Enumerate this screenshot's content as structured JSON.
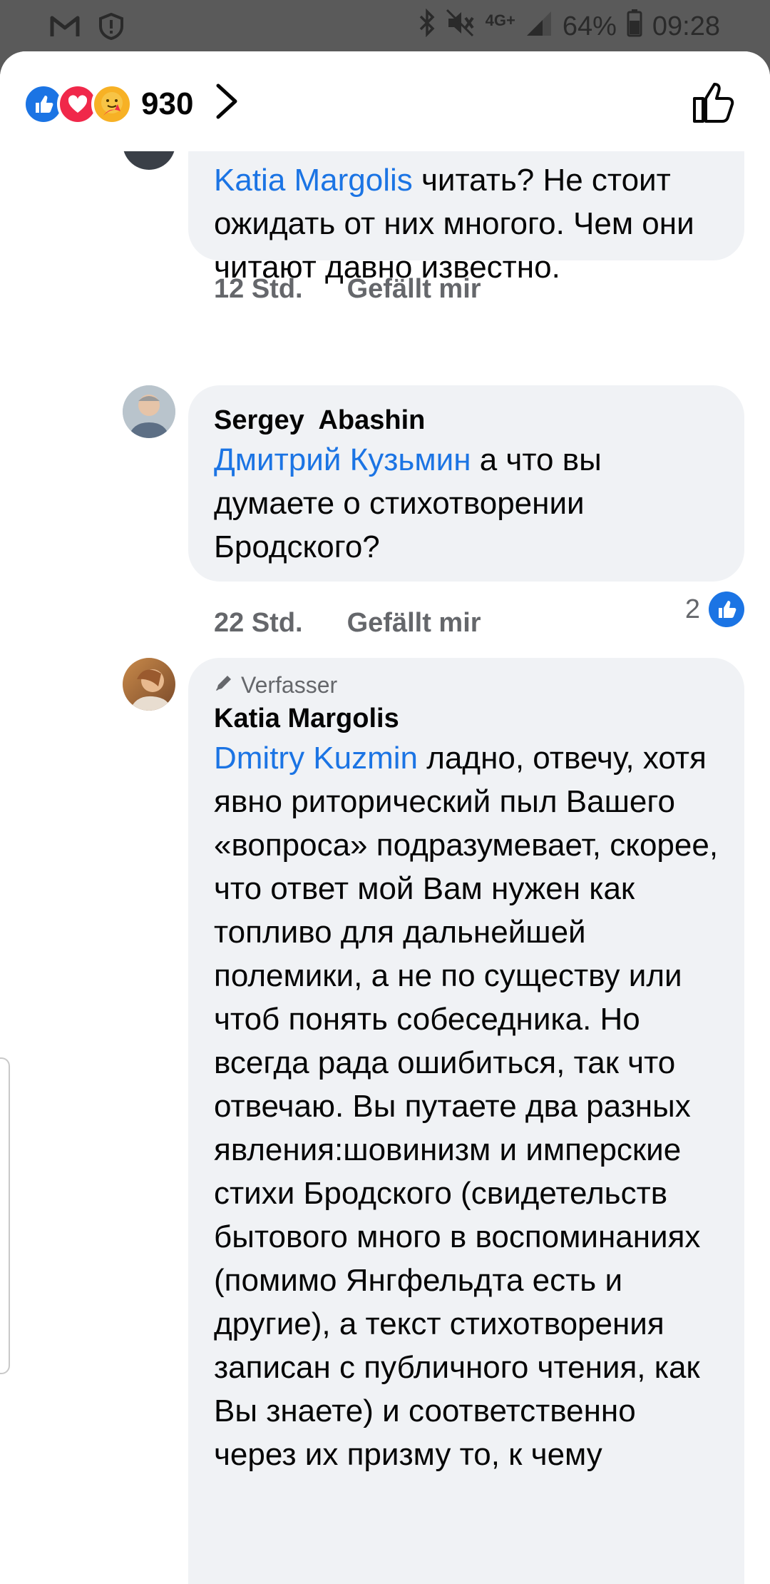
{
  "status_bar": {
    "left_icons": [
      "gmail-icon",
      "alert-icon"
    ],
    "network": "4G+",
    "battery": "64%",
    "time": "09:28"
  },
  "header": {
    "reactions": [
      "like",
      "love",
      "care"
    ],
    "count": "930"
  },
  "comments": [
    {
      "text_parts": [
        {
          "mention": true,
          "text": "Katia Margolis"
        },
        {
          "mention": false,
          "text": " читать? Не стоит ожидать от них многого. Чем они читают давно известно."
        }
      ],
      "time": "12 Std.",
      "like_label": "Gefällt mir"
    },
    {
      "author": "Sergey  Abashin",
      "text_parts": [
        {
          "mention": true,
          "text": "Дмитрий Кузьмин"
        },
        {
          "mention": false,
          "text": " а что вы думаете о стихотворении Бродского?"
        }
      ],
      "time": "22 Std.",
      "like_label": "Gefällt mir",
      "likes": "2"
    },
    {
      "badge": "Verfasser",
      "author": "Katia Margolis",
      "text_parts": [
        {
          "mention": true,
          "text": "Dmitry Kuzmin"
        },
        {
          "mention": false,
          "text": " ладно, отвечу, хотя явно риторический пыл Вашего «вопроса» подразумевает, скорее, что ответ мой Вам нужен как топливо для дальнейшей полемики, а не по существу или чтоб понять собеседника. Но всегда рада ошибиться, так что отвечаю. Вы путаете два разных явления:шовинизм и имперские стихи Бродского (свидетельств бытового много в воспоминаниях (помимо Янгфельдта есть и другие), а текст стихотворения записан с публичного чтения, как Вы знаете) и соответственно через их призму то, к чему"
        }
      ]
    }
  ],
  "colors": {
    "mention": "#1b74e4",
    "bubble": "#f0f2f5",
    "meta": "#65676b"
  }
}
